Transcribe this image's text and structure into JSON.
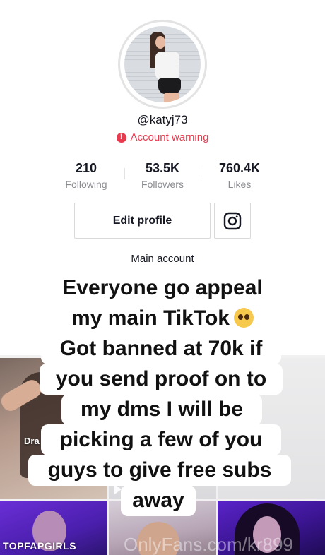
{
  "profile": {
    "username": "@katyj73",
    "warning": "Account warning",
    "stats": [
      {
        "value": "210",
        "label": "Following"
      },
      {
        "value": "53.5K",
        "label": "Followers"
      },
      {
        "value": "760.4K",
        "label": "Likes"
      }
    ],
    "edit_label": "Edit profile",
    "bio": "Main account",
    "colors": {
      "warning": "#e8394d",
      "text": "#161823",
      "muted": "#8a8b91"
    }
  },
  "grid": {
    "draft_label": "Dra"
  },
  "story": {
    "lines": [
      "Everyone go appeal",
      "my main TikTok",
      "Got banned at 70k if",
      "you send proof on to",
      "my dms I will be",
      "picking a few of you",
      "guys to give free subs",
      "away"
    ],
    "emoji": "pleading-face-emoji"
  },
  "watermarks": {
    "left": "TOPFAPGIRLS",
    "right": "OnlyFans.com/kr899"
  }
}
